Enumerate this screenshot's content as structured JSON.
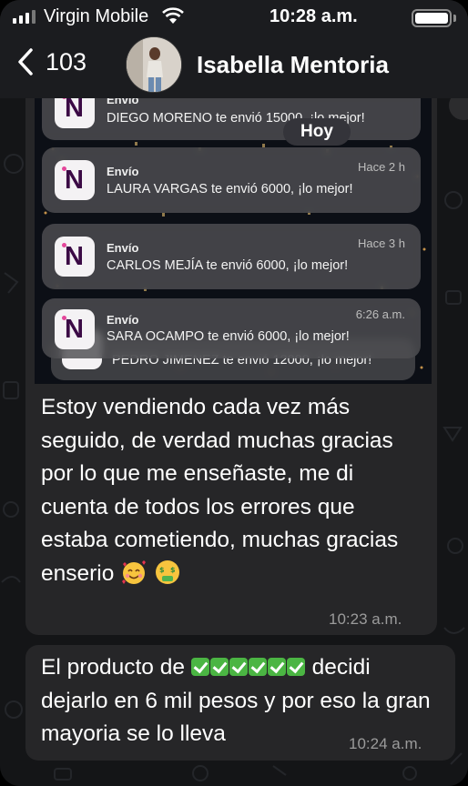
{
  "status_bar": {
    "carrier": "Virgin Mobile",
    "time": "10:28 a.m."
  },
  "header": {
    "back_count": "103",
    "contact_name": "Isabella Mentoria"
  },
  "date_chip": "Hoy",
  "notifications": [
    {
      "app": "Envío",
      "time": "",
      "text": "DIEGO MORENO te envió 15000, ¡lo mejor!"
    },
    {
      "app": "Envío",
      "time": "Hace 2 h",
      "text": "LAURA VARGAS te envió 6000, ¡lo mejor!"
    },
    {
      "app": "Envío",
      "time": "Hace 3 h",
      "text": "CARLOS MEJÍA te envió 6000, ¡lo mejor!"
    },
    {
      "app": "Envío",
      "time": "6:26 a.m.",
      "text": "SARA OCAMPO te envió 6000, ¡lo mejor!"
    },
    {
      "app": "",
      "time": "",
      "text": "PEDRO JIMENEZ te envió 12000, ¡lo mejor!"
    }
  ],
  "notification_icon_letter": "N",
  "messages": [
    {
      "text": "Estoy vendiendo cada vez más seguido, de verdad muchas gracias por lo que me enseñaste, me di cuenta de todos los errores que estaba cometiendo, muchas gracias enserio",
      "emojis": [
        "smiling-face-with-hearts",
        "money-mouth-face"
      ],
      "time": "10:23 a.m."
    },
    {
      "text_before": "El producto de",
      "text_after": "decidi dejarlo en 6 mil pesos y por eso la gran mayoria se lo lleva",
      "check_count": 6,
      "time": "10:24 a.m."
    }
  ],
  "colors": {
    "bubble": "#262628",
    "check": "#4bb543",
    "app_icon_letter": "#3b0a45"
  }
}
